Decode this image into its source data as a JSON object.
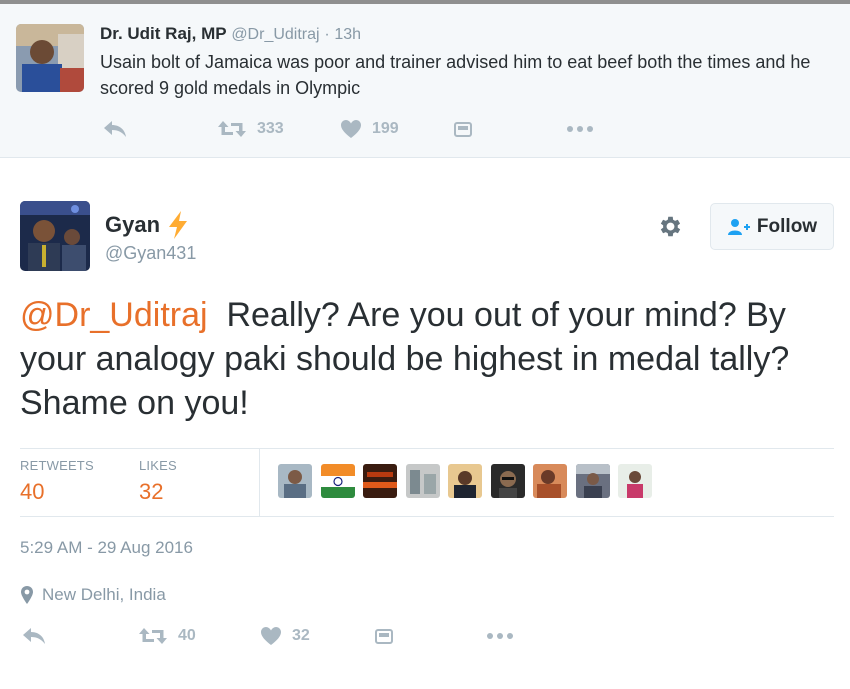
{
  "parent_tweet": {
    "name": "Dr. Udit Raj, MP",
    "handle": "@Dr_Uditraj",
    "separator": "·",
    "time": "13h",
    "text": "Usain bolt of Jamaica was poor and trainer advised him  to eat beef both the times and he scored 9 gold medals in Olympic",
    "retweets": "333",
    "likes": "199"
  },
  "tweet": {
    "name": "Gyan",
    "handle": "@Gyan431",
    "follow_label": "Follow",
    "mention": "@Dr_Uditraj",
    "text": "  Really? Are you out of your mind? By your analogy paki should be highest in medal tally?Shame on you!",
    "stats": {
      "retweets_label": "RETWEETS",
      "retweets": "40",
      "likes_label": "LIKES",
      "likes": "32"
    },
    "timestamp": "5:29 AM - 29 Aug 2016",
    "location": "New Delhi, India",
    "action_retweets": "40",
    "action_likes": "32"
  },
  "colors": {
    "accent": "#e8702a",
    "muted": "#8899a6",
    "icon": "#aab8c2",
    "text": "#292f33",
    "bolt": "#ffac33"
  },
  "icons": [
    "reply-icon",
    "retweet-icon",
    "heart-icon",
    "media-icon",
    "more-icon",
    "gear-icon",
    "follow-person-icon",
    "location-pin-icon",
    "lightning-bolt-icon"
  ]
}
